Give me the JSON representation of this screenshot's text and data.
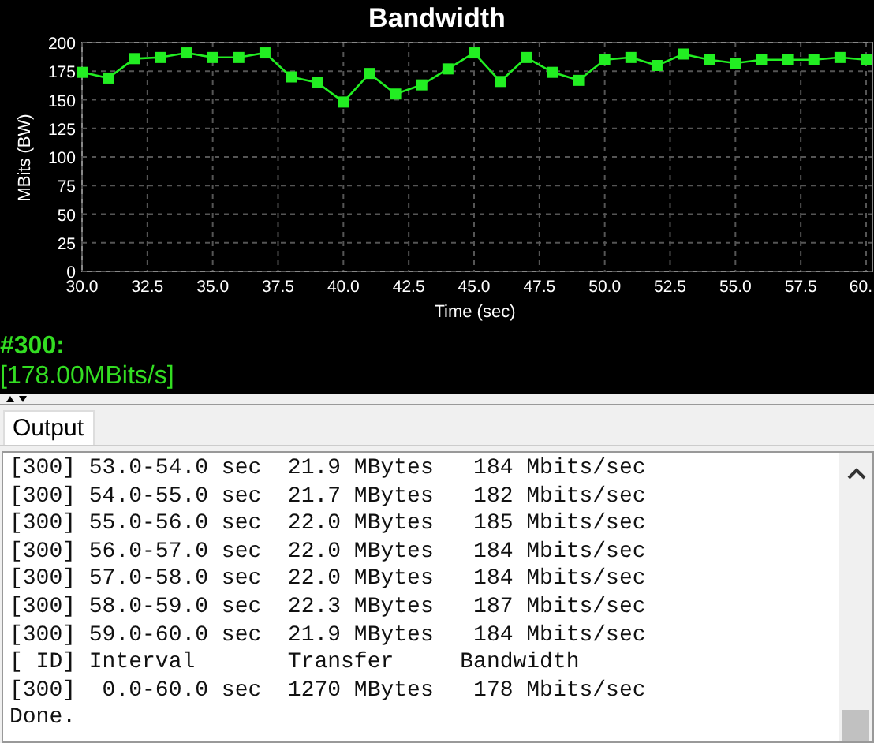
{
  "chart": {
    "chart_data": {
      "type": "line",
      "title": "Bandwidth",
      "xlabel": "Time (sec)",
      "ylabel": "MBits (BW)",
      "x": [
        30,
        31,
        32,
        33,
        34,
        35,
        36,
        37,
        38,
        39,
        40,
        41,
        42,
        43,
        44,
        45,
        46,
        47,
        48,
        49,
        50,
        51,
        52,
        53,
        54,
        55,
        56,
        57,
        58,
        59,
        60
      ],
      "grid": true,
      "series": [
        {
          "color": "#22ee22",
          "marker": "square",
          "values": [
            174,
            169,
            186,
            187,
            191,
            187,
            187,
            191,
            170,
            165,
            148,
            173,
            155,
            163,
            177,
            191,
            166,
            187,
            174,
            167,
            185,
            187,
            180,
            190,
            185,
            182,
            185,
            185,
            185,
            187,
            185
          ]
        }
      ],
      "xlim": [
        30,
        60
      ],
      "ylim": [
        0,
        200
      ],
      "xticks": [
        {
          "value": 30,
          "label": "30.0"
        },
        {
          "value": 32.5,
          "label": "32.5"
        },
        {
          "value": 35,
          "label": "35.0"
        },
        {
          "value": 37.5,
          "label": "37.5"
        },
        {
          "value": 40,
          "label": "40.0"
        },
        {
          "value": 42.5,
          "label": "42.5"
        },
        {
          "value": 45,
          "label": "45.0"
        },
        {
          "value": 47.5,
          "label": "47.5"
        },
        {
          "value": 50,
          "label": "50.0"
        },
        {
          "value": 52.5,
          "label": "52.5"
        },
        {
          "value": 55,
          "label": "55.0"
        },
        {
          "value": 57.5,
          "label": "57.5"
        },
        {
          "value": 60,
          "label": "60."
        }
      ],
      "yticks": [
        0,
        25,
        50,
        75,
        100,
        125,
        150,
        175,
        200
      ]
    }
  },
  "status": {
    "id_label": "#300:",
    "rate": "[178.00MBits/s]"
  },
  "tabs": [
    {
      "label": "Output",
      "selected": true
    }
  ],
  "output": {
    "lines": [
      "[300] 53.0-54.0 sec  21.9 MBytes   184 Mbits/sec",
      "[300] 54.0-55.0 sec  21.7 MBytes   182 Mbits/sec",
      "[300] 55.0-56.0 sec  22.0 MBytes   185 Mbits/sec",
      "[300] 56.0-57.0 sec  22.0 MBytes   184 Mbits/sec",
      "[300] 57.0-58.0 sec  22.0 MBytes   184 Mbits/sec",
      "[300] 58.0-59.0 sec  22.3 MBytes   187 Mbits/sec",
      "[300] 59.0-60.0 sec  21.9 MBytes   184 Mbits/sec",
      "[ ID] Interval       Transfer     Bandwidth",
      "[300]  0.0-60.0 sec  1270 MBytes   178 Mbits/sec",
      "Done."
    ]
  }
}
